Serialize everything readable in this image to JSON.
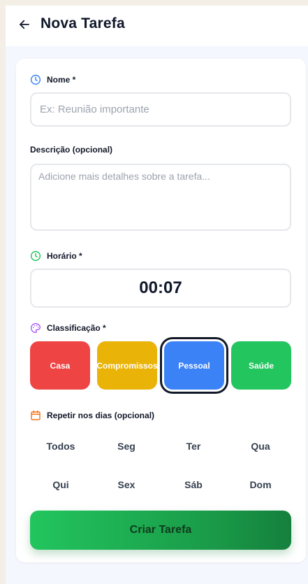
{
  "header": {
    "back_icon": "arrow-left-icon",
    "title": "Nova Tarefa"
  },
  "form": {
    "name": {
      "icon": "clock-icon",
      "label": "Nome *",
      "placeholder": "Ex: Reunião importante",
      "value": ""
    },
    "description": {
      "label": "Descrição (opcional)",
      "placeholder": "Adicione mais detalhes sobre a tarefa...",
      "value": ""
    },
    "time": {
      "icon": "clock-icon",
      "label": "Horário *",
      "value": "00:07"
    },
    "classification": {
      "icon": "palette-icon",
      "label": "Classificação *",
      "options": [
        {
          "label": "Casa",
          "color": "#ef4444"
        },
        {
          "label": "Compromissos",
          "color": "#eab308"
        },
        {
          "label": "Pessoal",
          "color": "#3b82f6"
        },
        {
          "label": "Saúde",
          "color": "#22c55e"
        }
      ],
      "selected": "Pessoal"
    },
    "repeat": {
      "icon": "calendar-icon",
      "label": "Repetir nos dias (opcional)",
      "days": [
        "Todos",
        "Seg",
        "Ter",
        "Qua",
        "Qui",
        "Sex",
        "Sáb",
        "Dom"
      ]
    },
    "submit_label": "Criar Tarefa"
  },
  "colors": {
    "accent_blue": "#3b82f6",
    "accent_green": "#22c55e",
    "accent_orange": "#f97316",
    "accent_purple": "#a855f7"
  }
}
